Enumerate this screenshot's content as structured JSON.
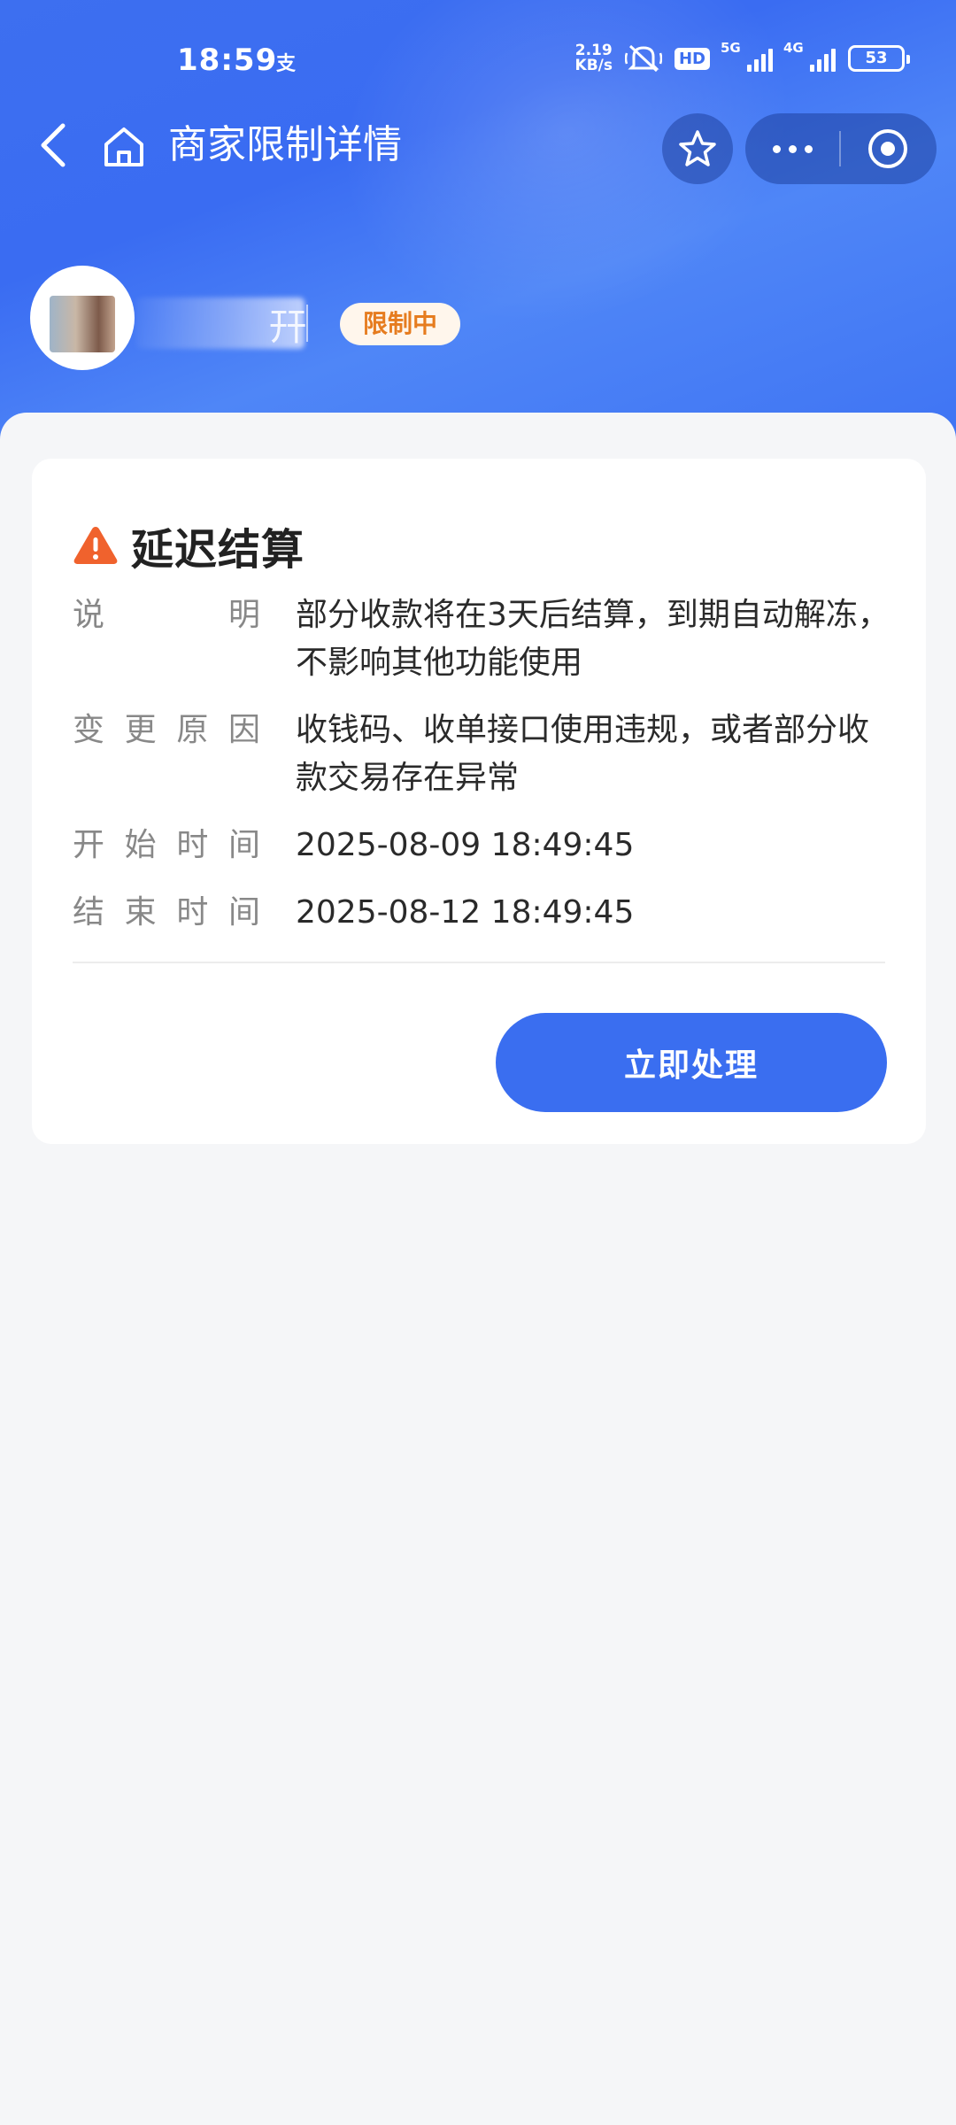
{
  "status_bar": {
    "time": "18:59",
    "app_indicator": "支",
    "net_speed_value": "2.19",
    "net_speed_unit": "KB/s",
    "hd_label": "HD",
    "signal_1": "5G",
    "signal_2": "4G",
    "battery": "53"
  },
  "nav": {
    "title": "商家限制详情",
    "icons": [
      "chevron-left-icon",
      "home-icon",
      "star-icon",
      "more-icon",
      "target-icon"
    ]
  },
  "merchant": {
    "name_visible_fragment": "幵",
    "status_badge": "限制中"
  },
  "card": {
    "title": "延迟结算",
    "title_icon": "warning-icon",
    "rows": [
      {
        "label_chars": [
          "说",
          "明"
        ],
        "value": "部分收款将在3天后结算，到期自动解冻，不影响其他功能使用"
      },
      {
        "label_chars": [
          "变",
          "更",
          "原",
          "因"
        ],
        "value": "收钱码、收单接口使用违规，或者部分收款交易存在异常"
      },
      {
        "label_chars": [
          "开",
          "始",
          "时",
          "间"
        ],
        "value": "2025-08-09 18:49:45"
      },
      {
        "label_chars": [
          "结",
          "束",
          "时",
          "间"
        ],
        "value": "2025-08-12 18:49:45"
      }
    ],
    "action_label": "立即处理"
  },
  "colors": {
    "header_blue": "#3d6ff0",
    "button_blue": "#3a6ef0",
    "badge_text": "#e67c1f",
    "badge_bg": "#fff6ec",
    "warning_orange": "#f0622d"
  }
}
